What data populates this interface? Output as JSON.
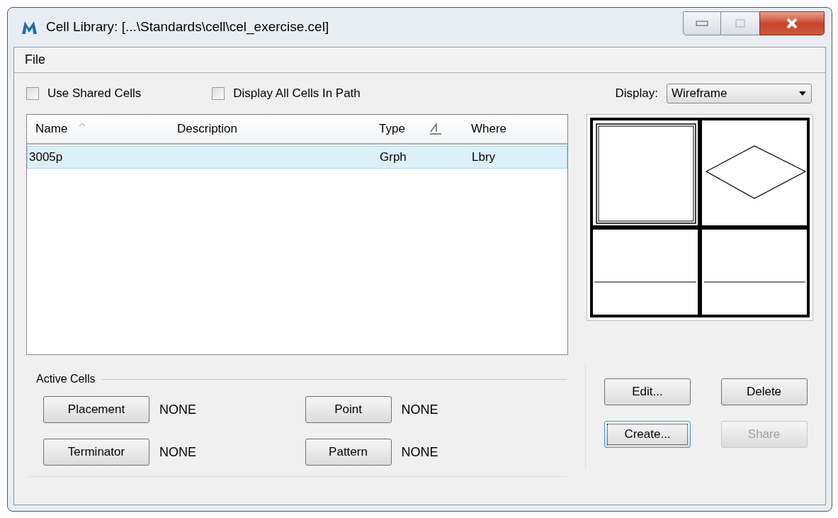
{
  "window": {
    "title": "Cell Library: [...\\Standards\\cell\\cel_exercise.cel]"
  },
  "menu": [
    "File"
  ],
  "checkboxes": [
    {
      "label": "Use Shared Cells",
      "checked": false
    },
    {
      "label": "Display All Cells In Path",
      "checked": false
    }
  ],
  "display": {
    "label": "Display:",
    "value": "Wireframe"
  },
  "table": {
    "columns": [
      {
        "label": "Name",
        "kind": "sorted"
      },
      {
        "label": "Description",
        "kind": "plain"
      },
      {
        "label": "Type",
        "kind": "plain"
      },
      {
        "kind": "level"
      },
      {
        "label": "Where",
        "kind": "plain"
      }
    ],
    "rows": [
      {
        "cells": [
          "3005p",
          null,
          "Grph",
          null,
          "Lbry"
        ],
        "selected": true
      }
    ]
  },
  "active_cells": {
    "title": "Active Cells",
    "items": [
      {
        "button": "Placement",
        "value": "NONE"
      },
      {
        "button": "Point",
        "value": "NONE"
      },
      {
        "button": "Terminator",
        "value": "NONE"
      },
      {
        "button": "Pattern",
        "value": "NONE"
      }
    ]
  },
  "actions": [
    {
      "label": "Edit...",
      "disabled": false,
      "focused": false
    },
    {
      "label": "Delete",
      "disabled": false,
      "focused": false
    },
    {
      "label": "Create...",
      "disabled": false,
      "focused": true
    },
    {
      "label": "Share",
      "disabled": true,
      "focused": false
    }
  ]
}
